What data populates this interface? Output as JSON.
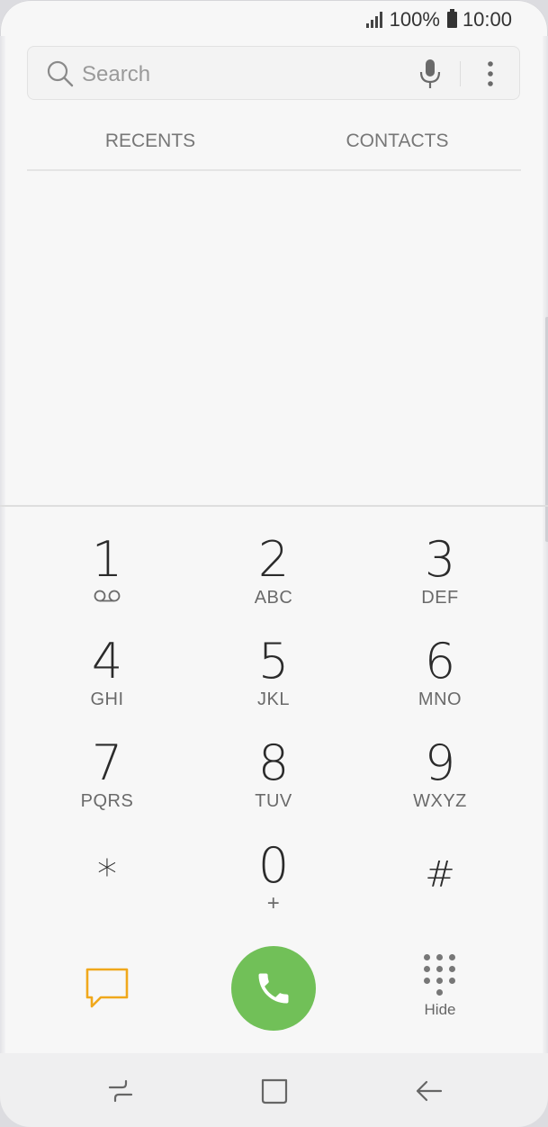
{
  "status_bar": {
    "battery_percent": "100%",
    "time": "10:00"
  },
  "search": {
    "placeholder": "Search"
  },
  "tabs": [
    {
      "label": "RECENTS"
    },
    {
      "label": "CONTACTS"
    }
  ],
  "keypad": [
    {
      "digit": "1",
      "letters": ""
    },
    {
      "digit": "2",
      "letters": "ABC"
    },
    {
      "digit": "3",
      "letters": "DEF"
    },
    {
      "digit": "4",
      "letters": "GHI"
    },
    {
      "digit": "5",
      "letters": "JKL"
    },
    {
      "digit": "6",
      "letters": "MNO"
    },
    {
      "digit": "7",
      "letters": "PQRS"
    },
    {
      "digit": "8",
      "letters": "TUV"
    },
    {
      "digit": "9",
      "letters": "WXYZ"
    },
    {
      "digit": "*",
      "letters": ""
    },
    {
      "digit": "0",
      "letters": "+"
    },
    {
      "digit": "#",
      "letters": ""
    }
  ],
  "actions": {
    "hide_label": "Hide"
  },
  "icons": {
    "search": "search-icon",
    "mic": "microphone-icon",
    "more": "more-options-icon",
    "voicemail": "voicemail-icon",
    "message": "message-icon",
    "call": "phone-icon",
    "dialpad": "dialpad-icon",
    "recent_apps": "recent-apps-icon",
    "home": "home-icon",
    "back": "back-icon"
  },
  "colors": {
    "call_green": "#71c058",
    "message_orange": "#f0a81c",
    "background": "#f7f7f7"
  }
}
